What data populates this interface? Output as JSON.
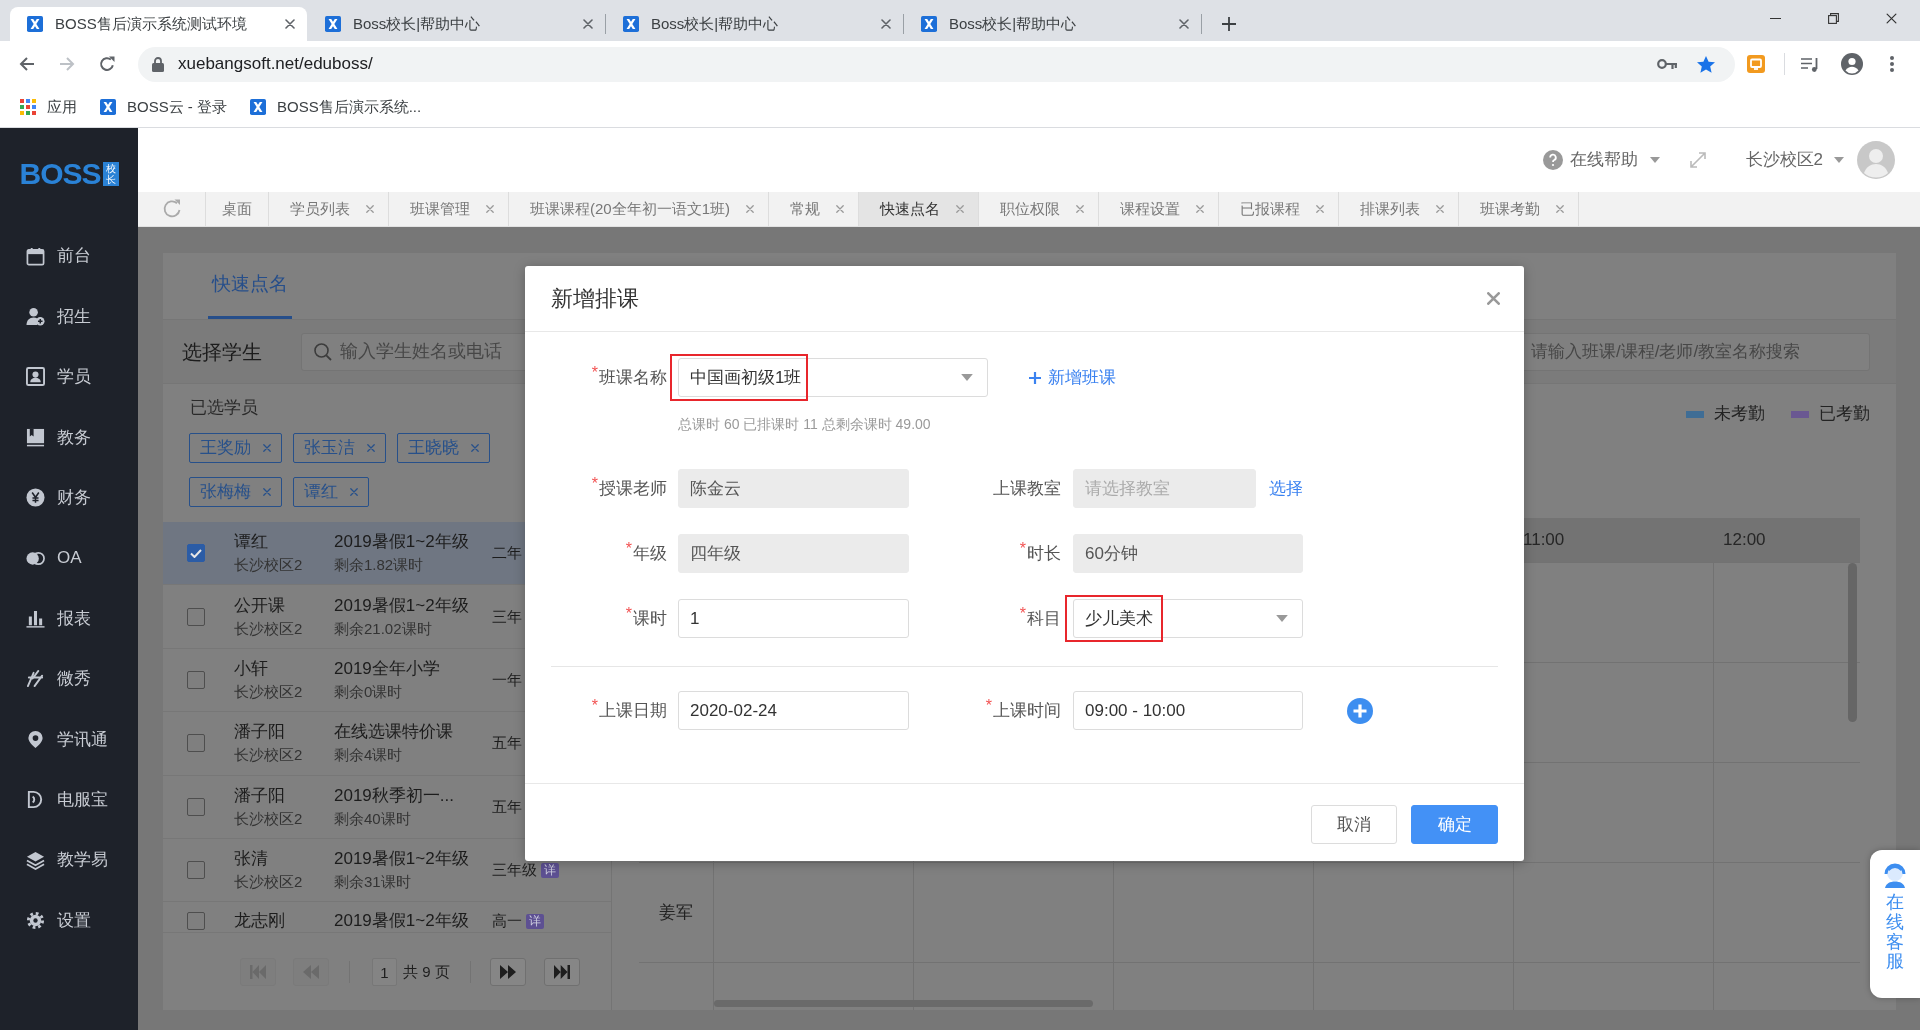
{
  "browser": {
    "tabs": [
      {
        "title": "BOSS售后演示系统测试环境",
        "selected": true
      },
      {
        "title": "Boss校长|帮助中心",
        "selected": false
      },
      {
        "title": "Boss校长|帮助中心",
        "selected": false
      },
      {
        "title": "Boss校长|帮助中心",
        "selected": false
      }
    ],
    "address": "xuebangsoft.net/eduboss/",
    "bookmarks": [
      {
        "kind": "apps",
        "label": "应用"
      },
      {
        "kind": "site",
        "label": "BOSS云 - 登录"
      },
      {
        "kind": "site",
        "label": "BOSS售后演示系统..."
      }
    ]
  },
  "logo": {
    "text": "BOSS",
    "badge": "校长"
  },
  "sidebar": {
    "items": [
      {
        "label": "前台"
      },
      {
        "label": "招生"
      },
      {
        "label": "学员"
      },
      {
        "label": "教务"
      },
      {
        "label": "财务"
      },
      {
        "label": "OA"
      },
      {
        "label": "报表"
      },
      {
        "label": "微秀"
      },
      {
        "label": "学讯通"
      },
      {
        "label": "电服宝"
      },
      {
        "label": "教学易"
      },
      {
        "label": "设置"
      }
    ]
  },
  "header": {
    "help": "在线帮助",
    "campus": "长沙校区2"
  },
  "page_tabs": [
    {
      "label": "桌面",
      "closable": false,
      "selected": false
    },
    {
      "label": "学员列表",
      "closable": true,
      "selected": false
    },
    {
      "label": "班课管理",
      "closable": true,
      "selected": false
    },
    {
      "label": "班课课程(20全年初一语文1班)",
      "closable": true,
      "selected": false
    },
    {
      "label": "常规",
      "closable": true,
      "selected": false
    },
    {
      "label": "快速点名",
      "closable": true,
      "selected": true
    },
    {
      "label": "职位权限",
      "closable": true,
      "selected": false
    },
    {
      "label": "课程设置",
      "closable": true,
      "selected": false
    },
    {
      "label": "已报课程",
      "closable": true,
      "selected": false
    },
    {
      "label": "排课列表",
      "closable": true,
      "selected": false
    },
    {
      "label": "班课考勤",
      "closable": true,
      "selected": false
    }
  ],
  "panel": {
    "tab": {
      "label": "快速点名",
      "selected": true
    },
    "select_label": "选择学生",
    "search": {
      "placeholder": "输入学生姓名或电话"
    },
    "selected_label": "已选学员",
    "chips": [
      {
        "name": "王奖励"
      },
      {
        "name": "张玉洁"
      },
      {
        "name": "王晓晓"
      },
      {
        "name": "张梅梅"
      },
      {
        "name": "谭红"
      }
    ],
    "students": [
      {
        "name": "谭红",
        "campus": "长沙校区2",
        "course": "2019暑假1~2年级",
        "remaining": "剩余1.82课时",
        "grade": "二年",
        "checked": true,
        "selected": true
      },
      {
        "name": "公开课",
        "campus": "长沙校区2",
        "course": "2019暑假1~2年级",
        "remaining": "剩余21.02课时",
        "grade": "三年",
        "checked": false,
        "selected": false
      },
      {
        "name": "小轩",
        "campus": "长沙校区2",
        "course": "2019全年小学",
        "remaining": "剩余0课时",
        "grade": "一年",
        "checked": false,
        "selected": false
      },
      {
        "name": "潘子阳",
        "campus": "长沙校区2",
        "course": "在线选课特价课",
        "remaining": "剩余4课时",
        "grade": "五年",
        "checked": false,
        "selected": false
      },
      {
        "name": "潘子阳",
        "campus": "长沙校区2",
        "course": "2019秋季初一...",
        "remaining": "剩余40课时",
        "grade": "五年",
        "checked": false,
        "selected": false
      },
      {
        "name": "张清",
        "campus": "长沙校区2",
        "course": "2019暑假1~2年级",
        "remaining": "剩余31课时",
        "grade": "三年级",
        "badge": "详",
        "checked": false,
        "selected": false
      },
      {
        "name": "龙志刚",
        "course": "2019暑假1~2年级",
        "grade": "高一",
        "badge": "详",
        "checked": false,
        "selected": false
      }
    ],
    "pagination": {
      "page": "1",
      "total": "共 9 页",
      "nav": [
        {
          "disabled": true
        },
        {
          "disabled": true
        },
        {
          "disabled": false
        },
        {
          "disabled": false
        }
      ]
    }
  },
  "schedule": {
    "search": {
      "placeholder": "请输入班课/课程/老师/教室名称搜索"
    },
    "legend": [
      {
        "label": "未考勤",
        "color": "#3f6d95"
      },
      {
        "label": "已考勤",
        "color": "#6a5892"
      }
    ],
    "times": [
      "11:00",
      "12:00"
    ],
    "teachers": [
      "姜军"
    ]
  },
  "dialog": {
    "title": "新增排课",
    "course": {
      "mark": "*",
      "label": "班课名称",
      "kind": "select",
      "value": "中国画初级1班",
      "disabled": false,
      "highlighted": true,
      "link": "新增班课",
      "hint": "总课时 60 已排课时 11 总剩余课时 49.00"
    },
    "sections": [
      {
        "rows": [
          [
            {
              "mark": "*",
              "label": "授课老师",
              "kind": "input",
              "value": "陈金云",
              "disabled": true
            },
            {
              "label": "上课教室",
              "kind": "input",
              "placeholder": "请选择教室",
              "disabled": true,
              "action": "选择"
            }
          ],
          [
            {
              "mark": "*",
              "label": "年级",
              "kind": "input",
              "value": "四年级",
              "disabled": true
            },
            {
              "mark": "*",
              "label": "时长",
              "kind": "input",
              "value": "60分钟",
              "disabled": true
            }
          ],
          [
            {
              "mark": "*",
              "label": "课时",
              "kind": "input",
              "value": "1",
              "disabled": false
            },
            {
              "mark": "*",
              "label": "科目",
              "kind": "select",
              "value": "少儿美术",
              "disabled": false,
              "highlighted": true
            }
          ]
        ]
      },
      {
        "rows": [
          [
            {
              "mark": "*",
              "label": "上课日期",
              "kind": "input",
              "value": "2020-02-24",
              "disabled": false
            },
            {
              "mark": "*",
              "label": "上课时间",
              "kind": "input",
              "value": "09:00 - 10:00",
              "disabled": false,
              "add": true
            }
          ]
        ]
      }
    ],
    "buttons": [
      {
        "label": "取消",
        "kind": "default"
      },
      {
        "label": "确定",
        "kind": "primary"
      }
    ]
  },
  "support": {
    "label": "在线客服"
  }
}
